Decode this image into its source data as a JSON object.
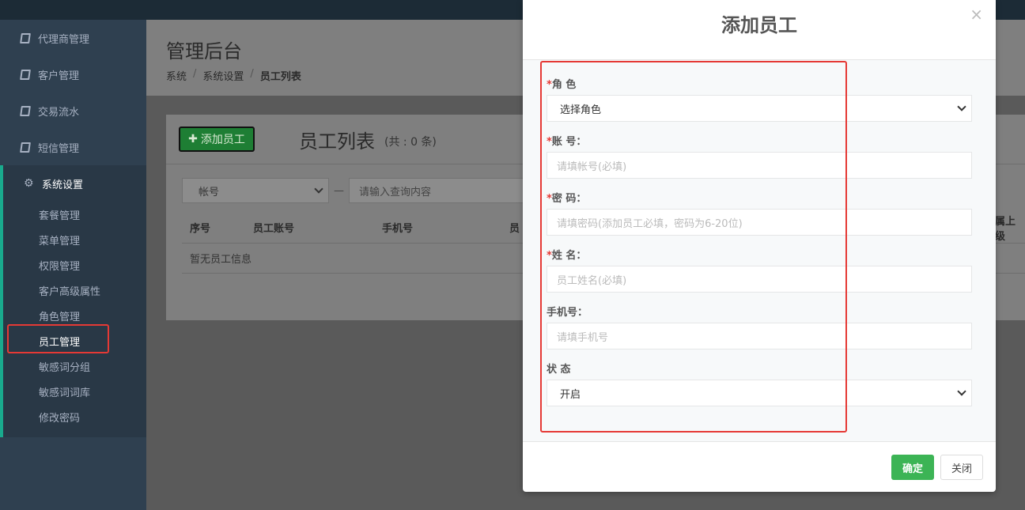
{
  "sidebar": {
    "items": [
      {
        "label": "代理商管理"
      },
      {
        "label": "客户管理"
      },
      {
        "label": "交易流水"
      },
      {
        "label": "短信管理"
      }
    ],
    "active_group": {
      "label": "系统设置",
      "children": [
        {
          "label": "套餐管理"
        },
        {
          "label": "菜单管理"
        },
        {
          "label": "权限管理"
        },
        {
          "label": "客户高级属性"
        },
        {
          "label": "角色管理"
        },
        {
          "label": "员工管理"
        },
        {
          "label": "敏感词分组"
        },
        {
          "label": "敏感词词库"
        },
        {
          "label": "修改密码"
        }
      ]
    }
  },
  "header": {
    "title": "管理后台",
    "breadcrumbs": [
      "系统",
      "系统设置",
      "员工列表"
    ]
  },
  "panel": {
    "add_button": "添加员工",
    "title": "员工列表",
    "count": "(共 : 0 条)",
    "filter_select": "帐号",
    "filter_dash": "—",
    "filter_placeholder": "请输入查询内容",
    "columns": [
      "序号",
      "员工账号",
      "手机号",
      "员",
      "属上级"
    ],
    "empty_text": "暂无员工信息"
  },
  "modal": {
    "title": "添加员工",
    "close_icon": "×",
    "fields": {
      "role": {
        "label": "角 色",
        "value": "选择角色"
      },
      "account": {
        "label": "账 号：",
        "placeholder": "请填帐号(必填)"
      },
      "password": {
        "label": "密 码：",
        "placeholder": "请填密码(添加员工必填，密码为6-20位)"
      },
      "name": {
        "label": "姓 名：",
        "placeholder": "员工姓名(必填)"
      },
      "phone": {
        "label": "手机号：",
        "placeholder": "请填手机号"
      },
      "status": {
        "label": "状 态",
        "value": "开启"
      }
    },
    "required_mark": "*",
    "ok_button": "确定",
    "close_button": "关闭"
  },
  "colors": {
    "sidebar_bg": "#2f4050",
    "accent_green": "#3cb455",
    "highlight_red": "#e53935"
  }
}
